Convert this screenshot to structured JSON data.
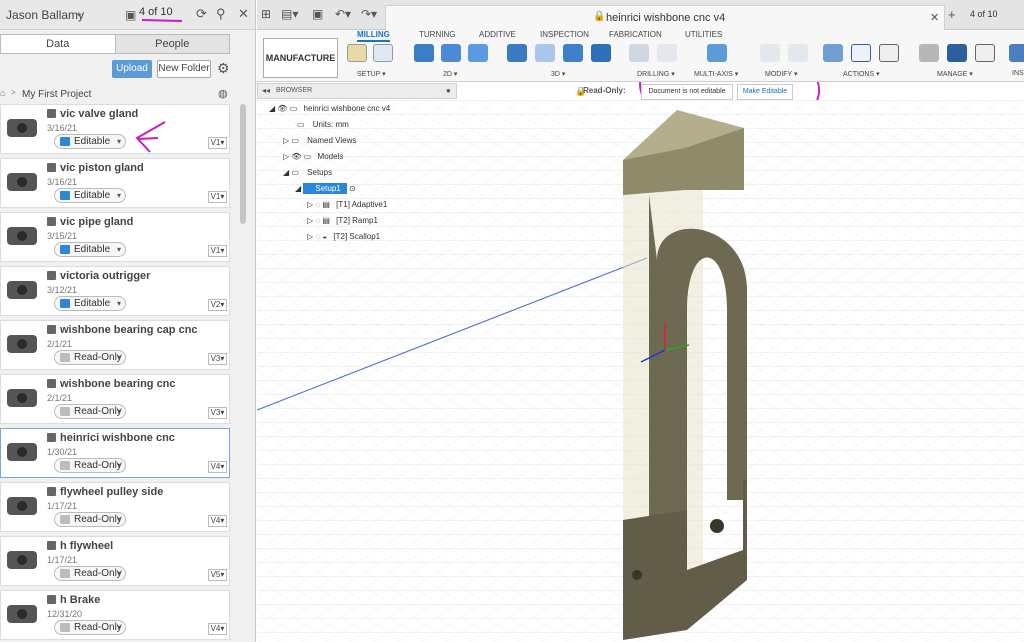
{
  "user": {
    "name": "Jason Ballamy",
    "jobs": "4 of 10"
  },
  "tabs": {
    "data": "Data",
    "people": "People"
  },
  "buttons": {
    "upload": "Upload",
    "new_folder": "New Folder"
  },
  "breadcrumb": "My First Project",
  "files": [
    {
      "name": "vic valve gland",
      "date": "3/16/21",
      "status": "Editable",
      "version": "V1"
    },
    {
      "name": "vic piston gland",
      "date": "3/16/21",
      "status": "Editable",
      "version": "V1"
    },
    {
      "name": "vic pipe gland",
      "date": "3/15/21",
      "status": "Editable",
      "version": "V1"
    },
    {
      "name": "victoria outrigger",
      "date": "3/12/21",
      "status": "Editable",
      "version": "V2"
    },
    {
      "name": "wishbone bearing cap cnc",
      "date": "2/1/21",
      "status": "Read-Only",
      "version": "V3"
    },
    {
      "name": "wishbone bearing cnc",
      "date": "2/1/21",
      "status": "Read-Only",
      "version": "V3"
    },
    {
      "name": "heinrici wishbone cnc",
      "date": "1/30/21",
      "status": "Read-Only",
      "version": "V4"
    },
    {
      "name": "flywheel pulley side",
      "date": "1/17/21",
      "status": "Read-Only",
      "version": "V4"
    },
    {
      "name": "h flywheel",
      "date": "1/17/21",
      "status": "Read-Only",
      "version": "V5"
    },
    {
      "name": "h Brake",
      "date": "12/31/20",
      "status": "Read-Only",
      "version": "V4"
    }
  ],
  "document": {
    "title": "heinrici wishbone cnc v4",
    "jobs": "4 of 10"
  },
  "ribbon": {
    "workspace": "MANUFACTURE",
    "tabs": [
      "MILLING",
      "TURNING",
      "ADDITIVE",
      "INSPECTION",
      "FABRICATION",
      "UTILITIES"
    ],
    "groups": [
      "SETUP",
      "2D",
      "3D",
      "DRILLING",
      "MULTI-AXIS",
      "MODIFY",
      "ACTIONS",
      "MANAGE",
      "INS"
    ]
  },
  "browser": {
    "label": "BROWSER",
    "root": "heinrici wishbone cnc v4",
    "units": "Units: mm",
    "named_views": "Named Views",
    "models": "Models",
    "setups": "Setups",
    "setup1": "Setup1",
    "ops": [
      "[T1] Adaptive1",
      "[T2] Ramp1",
      "[T2] Scallop1"
    ]
  },
  "readonly": {
    "label": "Read-Only:",
    "message": "Document is not editable",
    "action": "Make Editable"
  },
  "colors": {
    "accent": "#1a74c4",
    "editable": "#2f86d6",
    "readonly": "#bdbdbd",
    "annotation": "#c61ec6",
    "part": "#6e6a52"
  }
}
